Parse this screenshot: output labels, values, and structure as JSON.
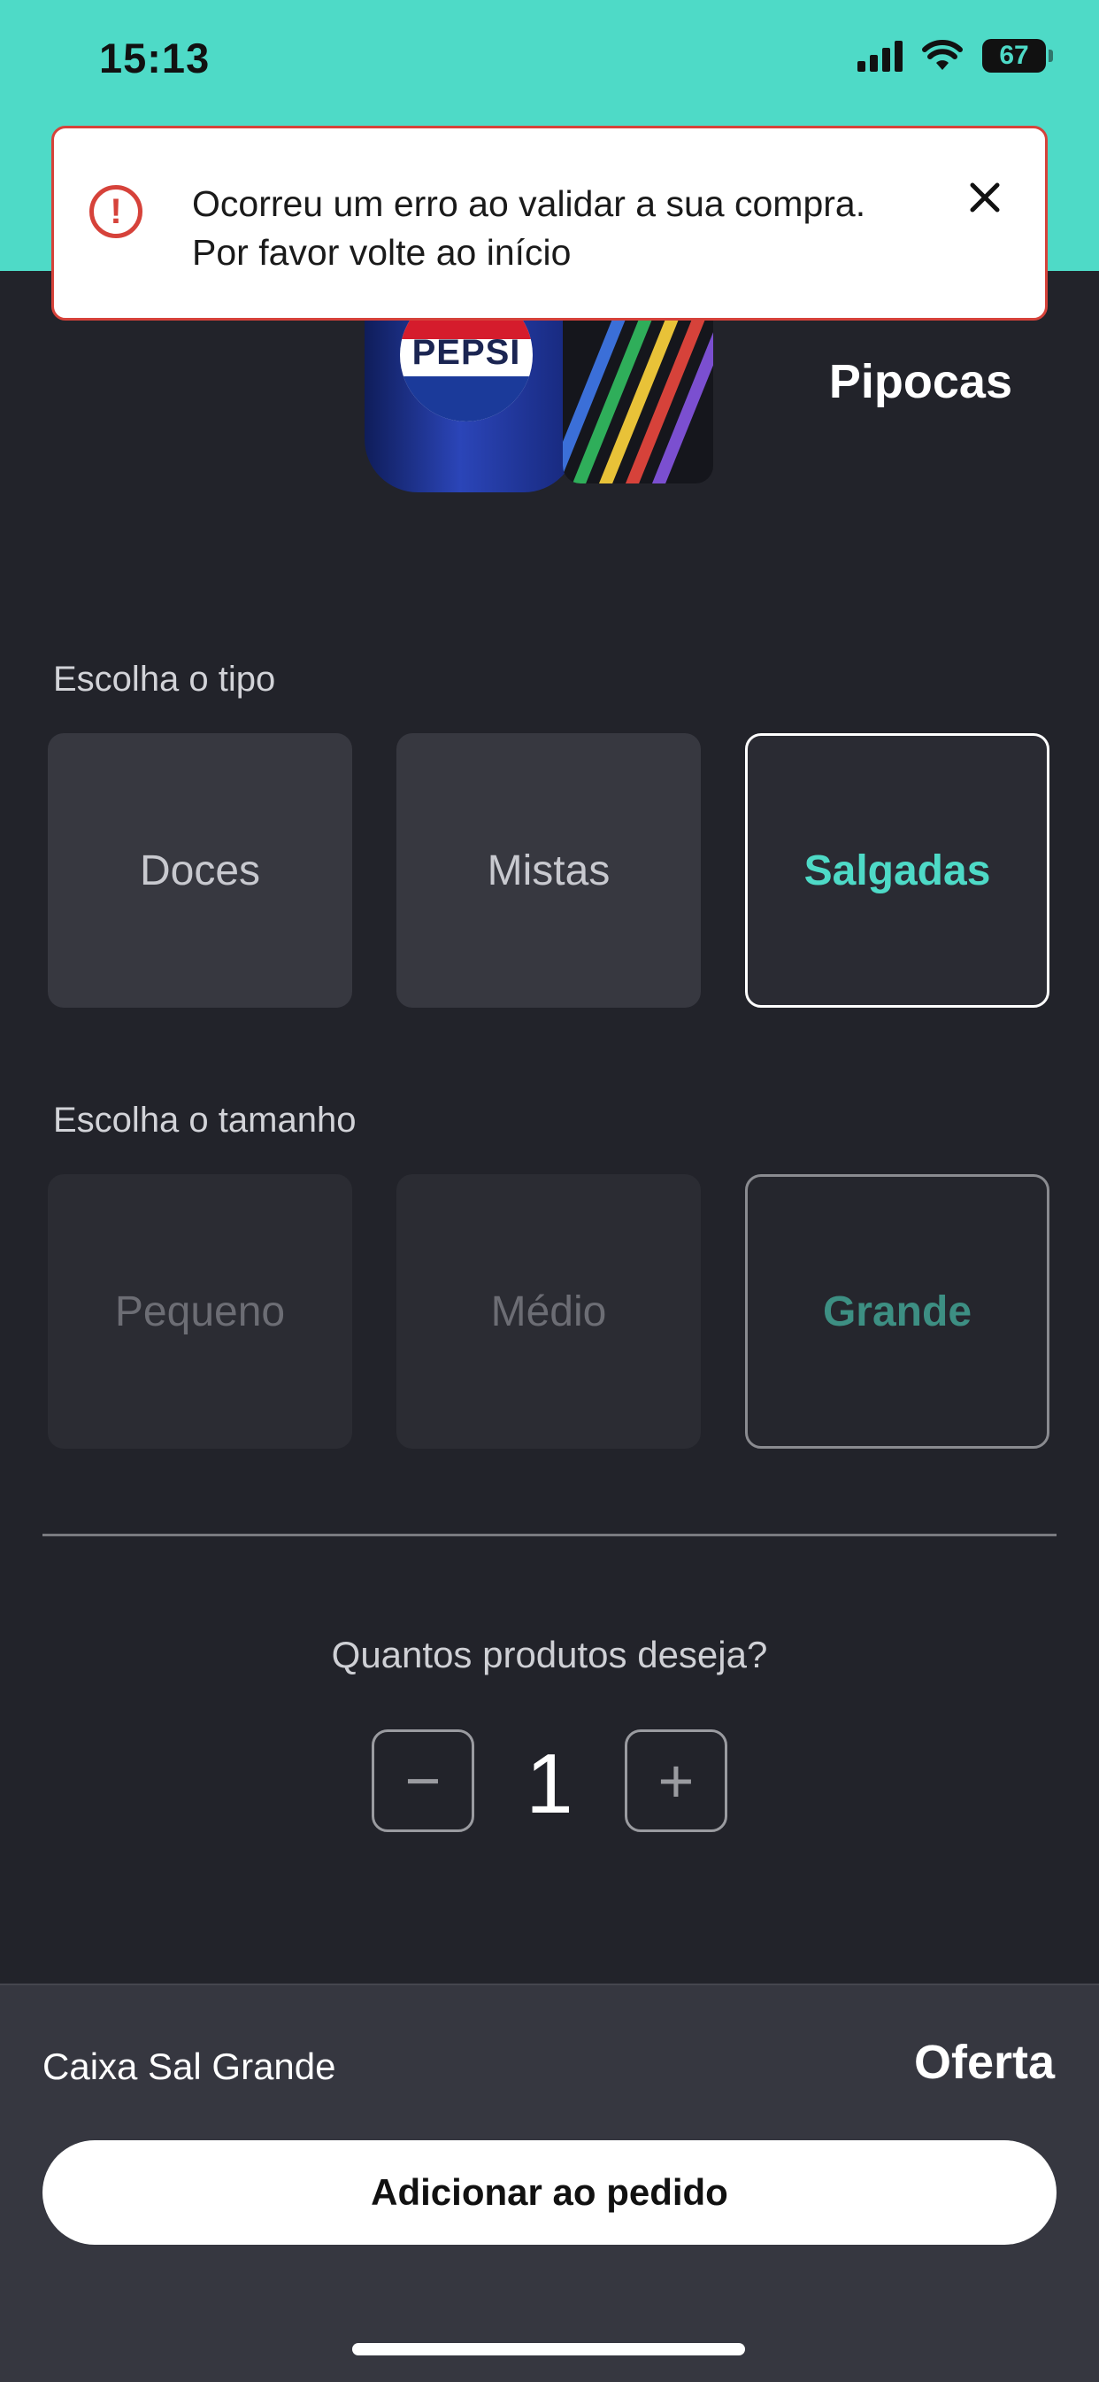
{
  "status_bar": {
    "time": "15:13",
    "battery": "67",
    "icons": [
      "cellular-signal-icon",
      "wifi-icon",
      "battery-icon"
    ]
  },
  "colors": {
    "accent": "#4edac7",
    "background": "#22232a",
    "error": "#d6423a"
  },
  "toast": {
    "message_line1": "Ocorreu um erro ao validar a sua compra.",
    "message_line2": "Por favor volte ao início",
    "icon": "error-alert-icon",
    "close_icon": "close-icon"
  },
  "product": {
    "image_logo": "PEPSI",
    "category_title": "Pipocas"
  },
  "type_section": {
    "label": "Escolha o tipo",
    "options": [
      {
        "label": "Doces",
        "selected": false
      },
      {
        "label": "Mistas",
        "selected": false
      },
      {
        "label": "Salgadas",
        "selected": true
      }
    ]
  },
  "size_section": {
    "label": "Escolha o tamanho",
    "options": [
      {
        "label": "Pequeno",
        "selected": false
      },
      {
        "label": "Médio",
        "selected": false
      },
      {
        "label": "Grande",
        "selected": true
      }
    ]
  },
  "quantity": {
    "label": "Quantos produtos deseja?",
    "value": "1",
    "decrement_symbol": "−",
    "increment_symbol": "+"
  },
  "summary": {
    "item_name": "Caixa Sal Grande",
    "price": "Oferta",
    "add_button": "Adicionar ao pedido"
  }
}
